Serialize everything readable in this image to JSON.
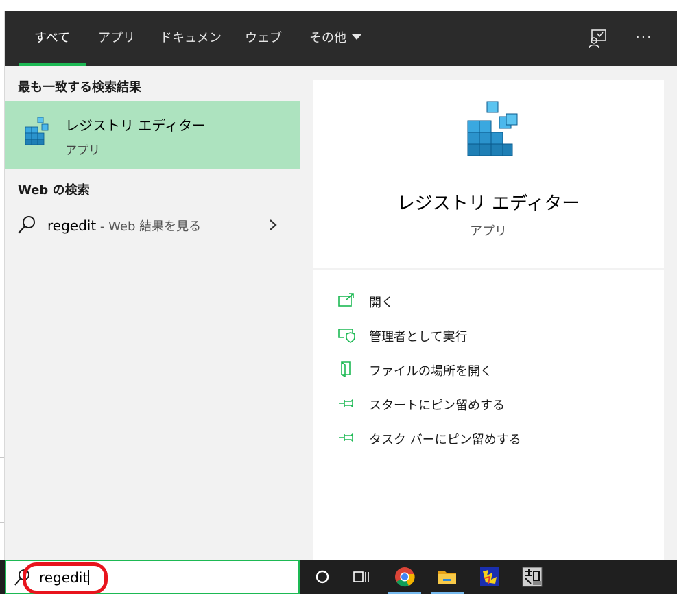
{
  "tabs": [
    {
      "label": "すべて",
      "active": true
    },
    {
      "label": "アプリ",
      "active": false
    },
    {
      "label": "ドキュメント",
      "active": false
    },
    {
      "label": "ウェブ",
      "active": false
    },
    {
      "label": "その他",
      "active": false
    }
  ],
  "toolbar": {
    "more_label": "···"
  },
  "best_match": {
    "heading": "最も一致する検索結果",
    "name": "レジストリ エディター",
    "type": "アプリ"
  },
  "web_search": {
    "heading": "Web の検索",
    "query": "regedit",
    "hint": " - Web 結果を見る"
  },
  "detail": {
    "name": "レジストリ エディター",
    "type": "アプリ",
    "actions": [
      {
        "label": "開く",
        "icon": "open-icon"
      },
      {
        "label": "管理者として実行",
        "icon": "shield-icon"
      },
      {
        "label": "ファイルの場所を開く",
        "icon": "file-location-icon"
      },
      {
        "label": "スタートにピン留めする",
        "icon": "pin-icon"
      },
      {
        "label": "タスク バーにピン留めする",
        "icon": "pin-icon"
      }
    ]
  },
  "search": {
    "value": "regedit"
  },
  "colors": {
    "accent": "#1db954",
    "highlight": "#ade3bf",
    "tabbar": "#2b2b2b",
    "annotation": "#e8141d"
  }
}
